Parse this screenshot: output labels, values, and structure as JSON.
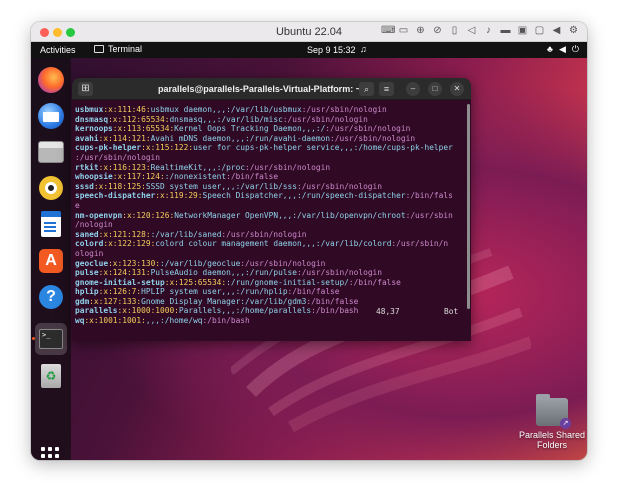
{
  "window": {
    "title": "Ubuntu 22.04"
  },
  "topbar": {
    "activities": "Activities",
    "app_name": "Terminal",
    "clock": "Sep 9  15:32"
  },
  "desktop": {
    "folder_label": "Parallels Shared Folders"
  },
  "terminal": {
    "title": "parallels@parallels-Parallels-Virtual-Platform: ~",
    "position": "48,37",
    "scroll_pos": "Bot",
    "lines": [
      {
        "user": "usbmux",
        "ids": ":x:111:46:",
        "gecos": "usbmux daemon,,,",
        "home": ":/var/lib/usbmux",
        "shell": ":/usr/sbin/nologin"
      },
      {
        "user": "dnsmasq",
        "ids": ":x:112:65534:",
        "gecos": "dnsmasq,,,",
        "home": ":/var/lib/misc",
        "shell": ":/usr/sbin/nologin"
      },
      {
        "user": "kernoops",
        "ids": ":x:113:65534:",
        "gecos": "Kernel Oops Tracking Daemon,,,",
        "home": ":/",
        "shell": ":/usr/sbin/nologin"
      },
      {
        "user": "avahi",
        "ids": ":x:114:121:",
        "gecos": "Avahi mDNS daemon,,,",
        "home": ":/run/avahi-daemon",
        "shell": ":/usr/sbin/nologin"
      },
      {
        "user": "cups-pk-helper",
        "ids": ":x:115:122:",
        "gecos": "user for cups-pk-helper service,,,",
        "home": ":/home/cups-pk-helper",
        "shell": ""
      },
      {
        "user": "",
        "ids": "",
        "gecos": "",
        "home": "",
        "shell": ":/usr/sbin/nologin"
      },
      {
        "user": "rtkit",
        "ids": ":x:116:123:",
        "gecos": "RealtimeKit,,,",
        "home": ":/proc",
        "shell": ":/usr/sbin/nologin"
      },
      {
        "user": "whoopsie",
        "ids": ":x:117:124:",
        "gecos": "",
        "home": ":/nonexistent",
        "shell": ":/bin/false"
      },
      {
        "user": "sssd",
        "ids": ":x:118:125:",
        "gecos": "SSSD system user,,,",
        "home": ":/var/lib/sss",
        "shell": ":/usr/sbin/nologin"
      },
      {
        "user": "speech-dispatcher",
        "ids": ":x:119:29:",
        "gecos": "Speech Dispatcher,,,",
        "home": ":/run/speech-dispatcher",
        "shell": ":/bin/fals"
      },
      {
        "user": "",
        "ids": "",
        "gecos": "",
        "home": "",
        "shell": "e"
      },
      {
        "user": "nm-openvpn",
        "ids": ":x:120:126:",
        "gecos": "NetworkManager OpenVPN,,,",
        "home": ":/var/lib/openvpn/chroot",
        "shell": ":/usr/sbin"
      },
      {
        "user": "",
        "ids": "",
        "gecos": "",
        "home": "",
        "shell": "/nologin"
      },
      {
        "user": "saned",
        "ids": ":x:121:128:",
        "gecos": "",
        "home": ":/var/lib/saned",
        "shell": ":/usr/sbin/nologin"
      },
      {
        "user": "colord",
        "ids": ":x:122:129:",
        "gecos": "colord colour management daemon,,,",
        "home": ":/var/lib/colord",
        "shell": ":/usr/sbin/n"
      },
      {
        "user": "",
        "ids": "",
        "gecos": "",
        "home": "",
        "shell": "ologin"
      },
      {
        "user": "geoclue",
        "ids": ":x:123:130:",
        "gecos": "",
        "home": ":/var/lib/geoclue",
        "shell": ":/usr/sbin/nologin"
      },
      {
        "user": "pulse",
        "ids": ":x:124:131:",
        "gecos": "PulseAudio daemon,,,",
        "home": ":/run/pulse",
        "shell": ":/usr/sbin/nologin"
      },
      {
        "user": "gnome-initial-setup",
        "ids": ":x:125:65534:",
        "gecos": "",
        "home": ":/run/gnome-initial-setup/",
        "shell": ":/bin/false"
      },
      {
        "user": "hplip",
        "ids": ":x:126:7:",
        "gecos": "HPLIP system user,,,",
        "home": ":/run/hplip",
        "shell": ":/bin/false"
      },
      {
        "user": "gdm",
        "ids": ":x:127:133:",
        "gecos": "Gnome Display Manager",
        "home": ":/var/lib/gdm3",
        "shell": ":/bin/false"
      },
      {
        "user": "parallels",
        "ids": ":x:1000:1000:",
        "gecos": "Parallels,,,",
        "home": ":/home/parallels",
        "shell": ":/bin/bash"
      },
      {
        "user": "wq",
        "ids": ":x:1001:1001:",
        "gecos": ",,,",
        "home": ":/home/wq",
        "shell": ":/bin/bash"
      }
    ]
  }
}
